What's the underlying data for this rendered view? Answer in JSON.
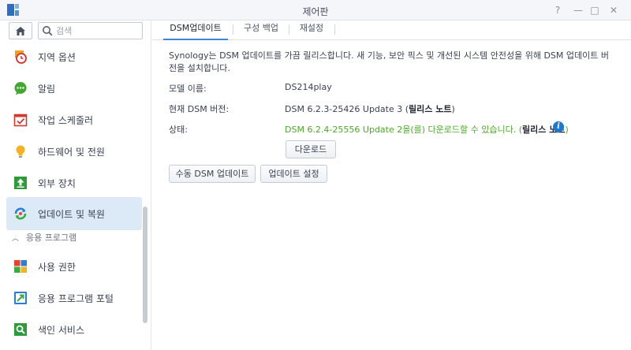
{
  "window": {
    "title": "제어판",
    "help_glyph": "?",
    "minimize_glyph": "—",
    "maximize_glyph": "□",
    "close_glyph": "✕"
  },
  "sidebar": {
    "search_placeholder": "검색",
    "items": [
      {
        "label": "지역 옵션",
        "icon": "clock-icon"
      },
      {
        "label": "알림",
        "icon": "chat-bubble-icon"
      },
      {
        "label": "작업 스케줄러",
        "icon": "calendar-check-icon"
      },
      {
        "label": "하드웨어 및 전원",
        "icon": "lightbulb-icon"
      },
      {
        "label": "외부 장치",
        "icon": "upload-arrow-icon"
      },
      {
        "label": "업데이트 및 복원",
        "icon": "refresh-icon",
        "active": true
      }
    ],
    "section_header": "응용 프로그램",
    "app_items": [
      {
        "label": "사용 권한",
        "icon": "grid-icon"
      },
      {
        "label": "응용 프로그램 포털",
        "icon": "portal-arrow-icon"
      },
      {
        "label": "색인 서비스",
        "icon": "index-search-icon"
      }
    ]
  },
  "tabs": [
    {
      "label": "DSM업데이트",
      "active": true
    },
    {
      "label": "구성 백업"
    },
    {
      "label": "재설정"
    }
  ],
  "content": {
    "description": "Synology는 DSM 업데이트를 가끔 릴리스합니다. 새 기능, 보안 픽스 및 개선된 시스템 안전성을 위해 DSM 업데이트 버전을 설치합니다.",
    "model_label": "모델 이름:",
    "model_value": "DS214play",
    "current_label": "현재 DSM 버전:",
    "current_value": "DSM 6.2.3-25426 Update 3 (",
    "current_link": "릴리스 노트",
    "current_close": ")",
    "status_label": "상태:",
    "status_value": "DSM 6.2.4-25556 Update 2을(를) 다운로드할 수 있습니다. (",
    "status_link": "릴리스 노트",
    "status_close": ")",
    "info_glyph": "i",
    "download_button": "다운로드",
    "manual_update_button": "수동 DSM 업데이트",
    "update_settings_button": "업데이트 설정"
  },
  "colors": {
    "accent": "#3b84d6",
    "active_bg": "#dce9f7",
    "status_green": "#4ea82a",
    "info_blue": "#1f77d0"
  }
}
